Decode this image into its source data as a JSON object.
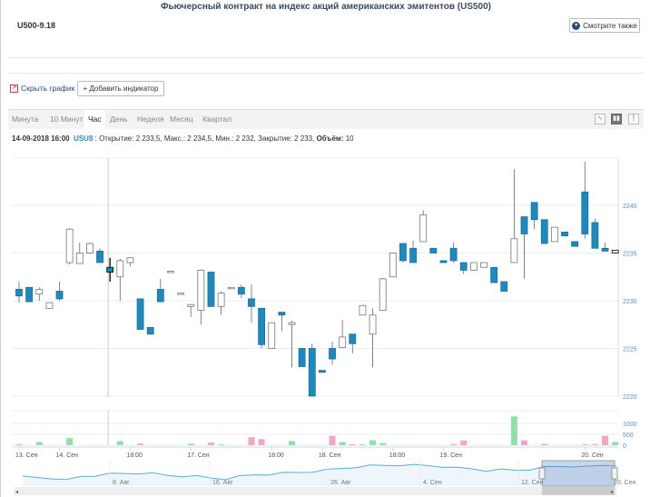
{
  "header": {
    "title": "Фьючерсный контракт на индекс акций американских эмитентов (US500)",
    "ticker": "U500-9.18",
    "see_also_label": "Смотрите также",
    "see_also_icon": "chevron-down-circle-icon"
  },
  "toolbar": {
    "hide_chart_label": "Скрыть график",
    "hide_chart_icon": "chart-icon",
    "add_indicator_label": "+ Добавить индикатор"
  },
  "tabs": [
    {
      "label": "Минута"
    },
    {
      "label": "10 Минут"
    },
    {
      "label": "Час",
      "active": true
    },
    {
      "label": "День"
    },
    {
      "label": "Неделя"
    },
    {
      "label": "Месяц"
    },
    {
      "label": "Квартал"
    }
  ],
  "chart_type_buttons": [
    {
      "icon": "line-chart-icon"
    },
    {
      "icon": "candlestick-icon",
      "active": true
    },
    {
      "icon": "bar-ohlc-icon"
    }
  ],
  "info": {
    "datetime": "14-09-2018 16:00",
    "symbol": "USU8",
    "text": " : Открытие: 2 233,5, Макс.: 2 234,5, Мин.: 2 232, Закрытие: 2 233, ",
    "volume_label": "Объём:",
    "volume_value": " 10"
  },
  "colors": {
    "down": "#1a8ac0",
    "up": "#ffffff",
    "vol_up": "#90e0a8",
    "vol_down": "#f4a6c0",
    "accent": "#2a8fc4"
  },
  "chart_data": {
    "type": "candlestick",
    "y_ticks": [
      "2220",
      "2225",
      "2230",
      "2235",
      "2240"
    ],
    "ylim": [
      2220,
      2245
    ],
    "volume_ticks": [
      "0",
      "500",
      "1000"
    ],
    "x_tick_labels": [
      "13. Сен",
      "14. Сен",
      "18:00",
      "17. Сен",
      "18:00",
      "18. Сен",
      "18:00",
      "19. Сен",
      "20. Сен"
    ],
    "x_tick_candle_index": [
      0,
      4,
      11,
      17,
      25,
      30,
      37,
      42,
      56
    ],
    "crosshair_index": 9,
    "candles": [
      [
        2231.2,
        2232,
        2229.8,
        2230.5
      ],
      [
        2231.4,
        2231.4,
        2229.9,
        2229.9
      ],
      [
        2230.7,
        2231.4,
        2230,
        2231.2
      ],
      [
        2229.2,
        2229.8,
        2229.2,
        2229.8
      ],
      [
        2231,
        2232,
        2230,
        2230.2
      ],
      [
        2234,
        2237.6,
        2233.8,
        2237.5
      ],
      [
        2233.9,
        2236.1,
        2233.9,
        2235
      ],
      [
        2235,
        2236.1,
        2234.9,
        2236
      ],
      [
        2235.2,
        2235.5,
        2234,
        2234
      ],
      [
        2233.5,
        2234.5,
        2232,
        2233
      ],
      [
        2232.5,
        2234.4,
        2230,
        2234.2
      ],
      [
        2234,
        2234.5,
        2233.6,
        2234.5
      ],
      [
        2230.2,
        2230.2,
        2227,
        2227
      ],
      [
        2227.2,
        2227.2,
        2226.5,
        2226.5
      ],
      [
        2231.2,
        2232.3,
        2229.9,
        2229.9
      ],
      [
        2233.1,
        2233.1,
        2233.1,
        2233.1
      ],
      [
        2230.8,
        2230.8,
        2230.8,
        2230.8
      ],
      [
        2229.4,
        2229.6,
        2228.3,
        2229.6
      ],
      [
        2229,
        2233.3,
        2227.5,
        2233.2
      ],
      [
        2233,
        2233,
        2229.4,
        2229.4
      ],
      [
        2229.4,
        2231,
        2228.5,
        2230.8
      ],
      [
        2231.4,
        2231.4,
        2231.4,
        2231.4
      ],
      [
        2231.4,
        2231.7,
        2230.3,
        2230.7
      ],
      [
        2230.2,
        2231.7,
        2227.7,
        2229.4
      ],
      [
        2229.2,
        2229.2,
        2225,
        2225.4
      ],
      [
        2225,
        2227.7,
        2225,
        2227.7
      ],
      [
        2228.8,
        2228.8,
        2226.8,
        2228.5
      ],
      [
        2227.5,
        2227.9,
        2223,
        2227.7
      ],
      [
        2225,
        2225,
        2223.1,
        2223.1
      ],
      [
        2225,
        2225.5,
        2220,
        2220
      ],
      [
        2222.7,
        2222.7,
        2222.5,
        2222.5
      ],
      [
        2225,
        2225.7,
        2223.3,
        2223.9
      ],
      [
        2225.1,
        2228,
        2225.1,
        2226.2
      ],
      [
        2226.5,
        2226.5,
        2224.5,
        2225.5
      ],
      [
        2228.5,
        2229.5,
        2228.5,
        2229.5
      ],
      [
        2226.5,
        2229.2,
        2223,
        2228.5
      ],
      [
        2229,
        2232.4,
        2229,
        2232.3
      ],
      [
        2232.5,
        2235,
        2232.5,
        2235
      ],
      [
        2236,
        2236,
        2234,
        2234.2
      ],
      [
        2235.5,
        2236.3,
        2234,
        2234
      ],
      [
        2236.2,
        2239.5,
        2236.2,
        2239
      ],
      [
        2235.5,
        2235.5,
        2235,
        2235
      ],
      [
        2234.2,
        2234.2,
        2234,
        2234
      ],
      [
        2235.5,
        2236.1,
        2234,
        2234.2
      ],
      [
        2234,
        2234,
        2232.8,
        2233.2
      ],
      [
        2233.2,
        2234,
        2233.2,
        2234
      ],
      [
        2233.5,
        2234,
        2233.5,
        2234
      ],
      [
        2233.5,
        2233.5,
        2231.9,
        2231.9
      ],
      [
        2232,
        2232,
        2231,
        2231
      ],
      [
        2234,
        2243.8,
        2234,
        2236.5
      ],
      [
        2238.8,
        2238.8,
        2232.3,
        2237
      ],
      [
        2240.3,
        2240.3,
        2237.5,
        2238.5
      ],
      [
        2238.5,
        2238.5,
        2236,
        2236
      ],
      [
        2236.2,
        2237.7,
        2236.2,
        2237.7
      ],
      [
        2237.2,
        2237.2,
        2236.8,
        2236.8
      ],
      [
        2236.2,
        2236.2,
        2235.7,
        2235.7
      ],
      [
        2241.4,
        2244.6,
        2236.5,
        2237
      ],
      [
        2238.2,
        2238.6,
        2235.5,
        2235.5
      ],
      [
        2235.5,
        2236.1,
        2235.2,
        2235.2
      ],
      [
        2235,
        2235.3,
        2235,
        2235.3
      ]
    ],
    "volumes": [
      50,
      0,
      150,
      0,
      0,
      330,
      0,
      0,
      0,
      0,
      190,
      0,
      70,
      0,
      0,
      0,
      0,
      70,
      0,
      120,
      40,
      0,
      0,
      370,
      280,
      0,
      0,
      190,
      0,
      0,
      0,
      430,
      150,
      40,
      40,
      230,
      100,
      0,
      0,
      0,
      0,
      0,
      0,
      50,
      220,
      0,
      0,
      0,
      0,
      1320,
      220,
      0,
      60,
      0,
      0,
      0,
      40,
      50,
      430,
      150
    ],
    "navigator": {
      "labels": [
        "8. Авг",
        "16. Авг",
        "26. Авг",
        "4. Сен",
        "12. Сен",
        "20. Сен"
      ],
      "series": [
        0.28,
        0.25,
        0.22,
        0.1,
        0.3,
        0.35,
        0.42,
        0.45,
        0.47,
        0.44,
        0.35,
        0.33,
        0.3,
        0.22,
        0.18,
        0.3,
        0.38,
        0.42,
        0.46,
        0.5,
        0.55,
        0.62,
        0.7,
        0.78,
        0.83,
        0.85,
        0.88,
        0.86,
        0.84,
        0.8,
        0.72,
        0.68,
        0.6,
        0.63,
        0.62,
        0.66,
        0.75,
        0.8,
        0.82,
        0.78,
        0.85,
        0.88
      ]
    }
  }
}
